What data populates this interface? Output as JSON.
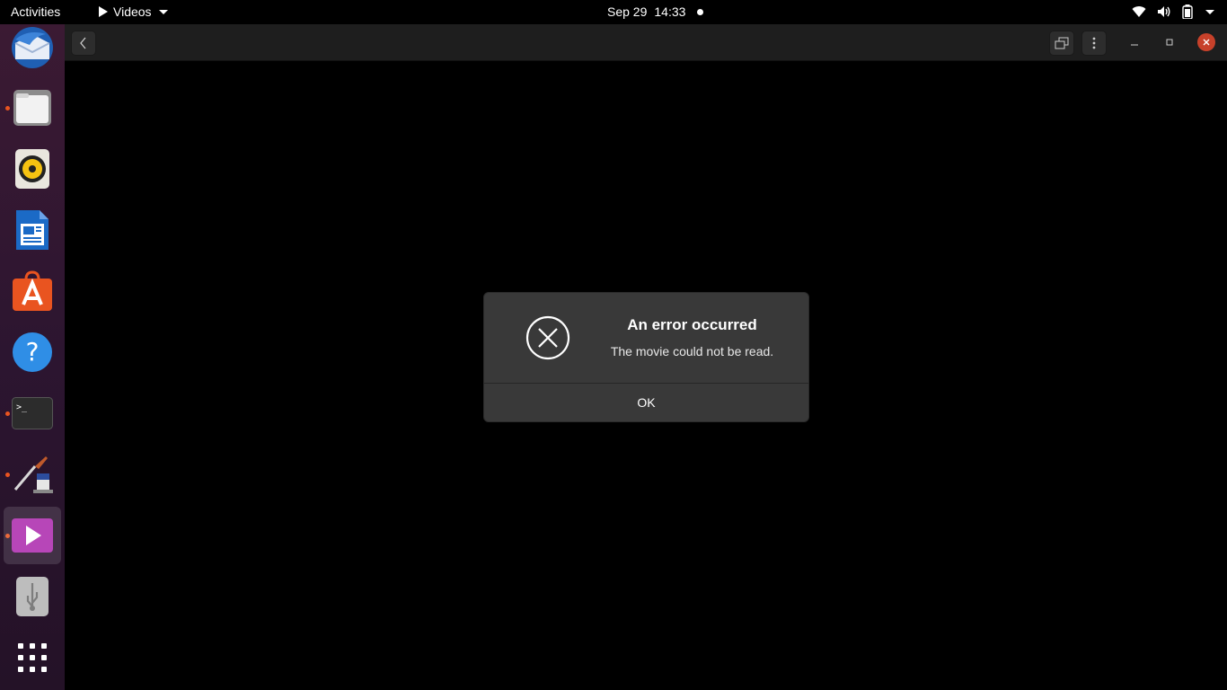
{
  "topbar": {
    "activities": "Activities",
    "app_name": "Videos",
    "date": "Sep 29",
    "time": "14:33"
  },
  "dock": {
    "items": [
      {
        "name": "thunderbird",
        "running": false
      },
      {
        "name": "files",
        "running": true
      },
      {
        "name": "rhythmbox",
        "running": false
      },
      {
        "name": "libreoffice-writer",
        "running": false
      },
      {
        "name": "ubuntu-software",
        "running": false
      },
      {
        "name": "help",
        "running": false
      },
      {
        "name": "terminal",
        "running": true
      },
      {
        "name": "drawing",
        "running": true
      },
      {
        "name": "videos",
        "running": true,
        "active": true
      },
      {
        "name": "usb-drive",
        "running": false
      },
      {
        "name": "show-applications",
        "running": false
      }
    ]
  },
  "dialog": {
    "title": "An error occurred",
    "message": "The movie could not be read.",
    "ok_label": "OK"
  },
  "colors": {
    "accent": "#e95420",
    "close_button": "#c7412a",
    "dialog_bg": "#393939",
    "headerbar_bg": "#1e1e1e"
  }
}
